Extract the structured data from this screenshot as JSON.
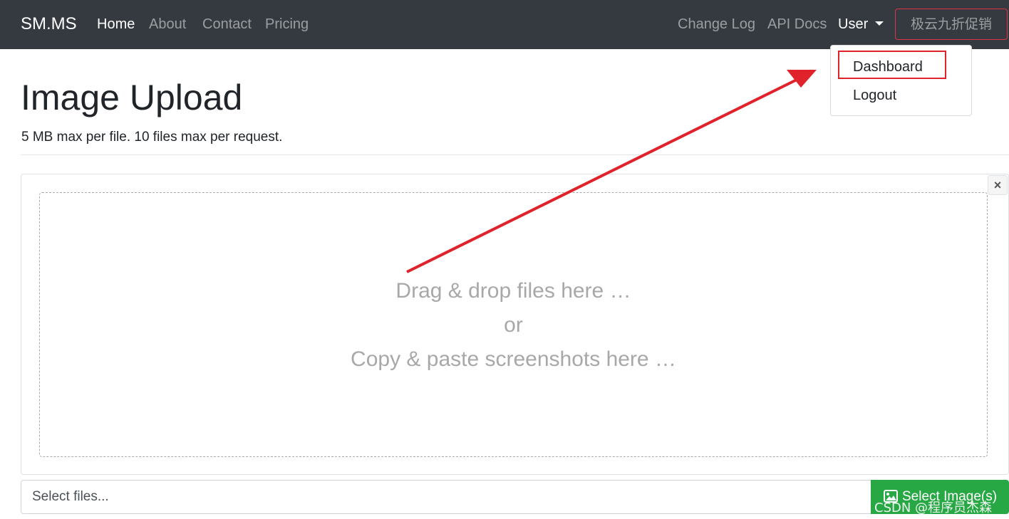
{
  "navbar": {
    "brand": "SM.MS",
    "left_links": [
      "Home",
      "About",
      "Contact",
      "Pricing"
    ],
    "active": "Home",
    "change_log": "Change Log",
    "api_docs": "API Docs",
    "user_menu": "User",
    "promo": "极云九折促销"
  },
  "dropdown": {
    "items": [
      "Dashboard",
      "Logout"
    ],
    "highlighted": "Dashboard"
  },
  "page": {
    "title": "Image Upload",
    "subtitle": "5 MB max per file. 10 files max per request."
  },
  "dropzone": {
    "line1": "Drag & drop files here …",
    "line2": "or",
    "line3": "Copy & paste screenshots here …",
    "close": "×"
  },
  "file_input": {
    "placeholder": "Select files...",
    "button_label": "Select Image(s)",
    "button_icon": "image-icon"
  },
  "watermark": "CSDN @程序员杰森",
  "colors": {
    "navbar_bg": "#343a40",
    "accent_red": "#e0232b",
    "success": "#28a745"
  }
}
